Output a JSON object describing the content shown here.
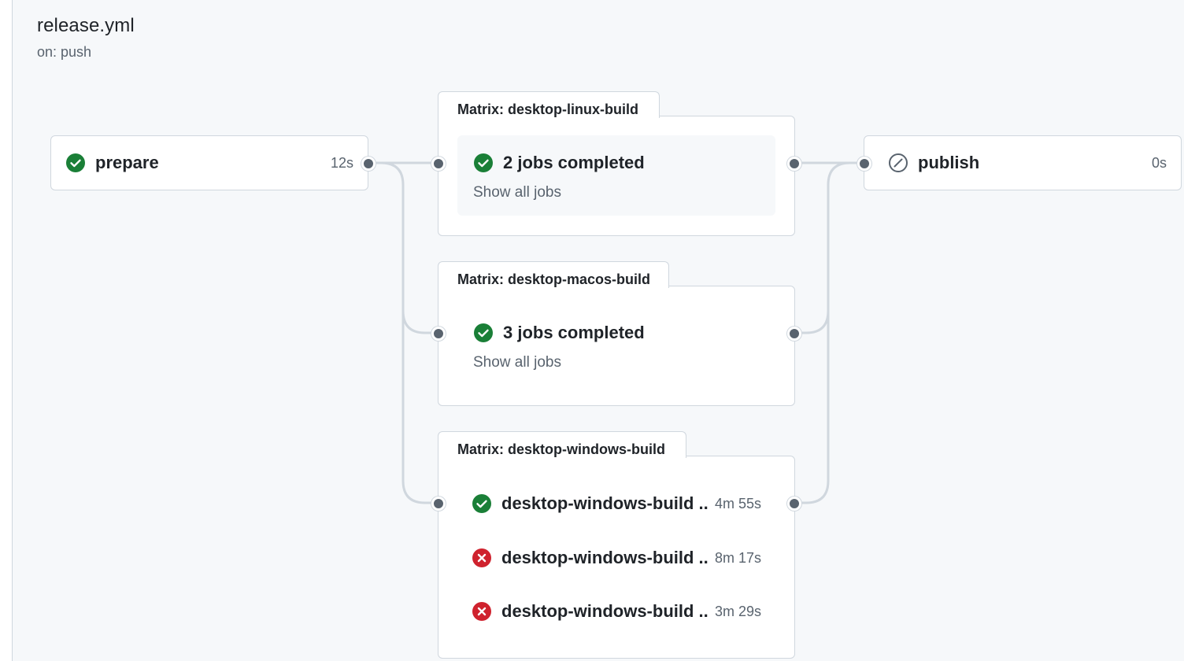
{
  "workflow": {
    "title": "release.yml",
    "trigger": "on: push"
  },
  "jobs": {
    "prepare": {
      "name": "prepare",
      "duration": "12s",
      "status": "success",
      "icon": "check-circle-icon"
    },
    "publish": {
      "name": "publish",
      "duration": "0s",
      "status": "skipped",
      "icon": "skip-icon"
    }
  },
  "matrices": [
    {
      "label": "Matrix: desktop-linux-build",
      "summary": "2 jobs completed",
      "show_all": "Show all jobs",
      "status": "success"
    },
    {
      "label": "Matrix: desktop-macos-build",
      "summary": "3 jobs completed",
      "show_all": "Show all jobs",
      "status": "success"
    },
    {
      "label": "Matrix: desktop-windows-build",
      "jobs": [
        {
          "name": "desktop-windows-build ...",
          "duration": "4m 55s",
          "status": "success",
          "icon": "check-circle-icon"
        },
        {
          "name": "desktop-windows-build ...",
          "duration": "8m 17s",
          "status": "failure",
          "icon": "x-circle-icon"
        },
        {
          "name": "desktop-windows-build ...",
          "duration": "3m 29s",
          "status": "failure",
          "icon": "x-circle-icon"
        }
      ]
    }
  ],
  "colors": {
    "success": "#1a7f37",
    "failure": "#cf222e",
    "muted": "#59636e",
    "border": "#d0d7de",
    "connector": "#d0d7de"
  }
}
